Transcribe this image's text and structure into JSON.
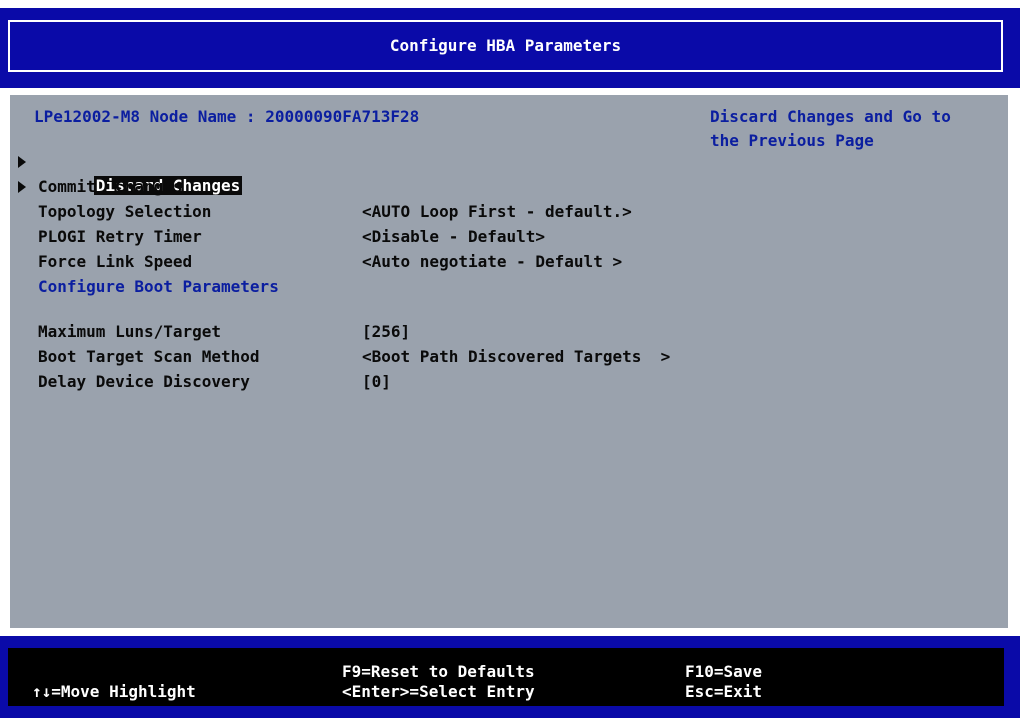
{
  "header": {
    "title": "Configure HBA Parameters"
  },
  "panel": {
    "node_name": "LPe12002-M8 Node Name : 20000090FA713F28",
    "help_text_line1": "Discard Changes and Go to",
    "help_text_line2": "the Previous Page",
    "menu": {
      "discard_changes": "Discard Changes",
      "commit_changes": "Commit  Changes"
    },
    "settings": [
      {
        "label": "Topology Selection",
        "value": "<AUTO Loop First - default.>"
      },
      {
        "label": "PLOGI Retry Timer",
        "value": "<Disable - Default>"
      },
      {
        "label": "Force Link Speed",
        "value": "<Auto negotiate - Default >"
      }
    ],
    "boot_section_title": "Configure Boot Parameters",
    "boot_settings": [
      {
        "label": "Maximum Luns/Target",
        "value": "[256]"
      },
      {
        "label": "Boot Target Scan Method",
        "value": "<Boot Path Discovered Targets  >"
      },
      {
        "label": "Delay Device Discovery",
        "value": "[0]"
      }
    ]
  },
  "footer": {
    "move_highlight": "↑↓=Move Highlight",
    "reset_defaults": "F9=Reset to Defaults",
    "select_entry": "<Enter>=Select Entry",
    "save": "F10=Save",
    "exit": "Esc=Exit"
  },
  "colors": {
    "header_bg": "#0a0aa8",
    "panel_bg": "#9aa2ad",
    "accent_text": "#0b1ea0"
  }
}
